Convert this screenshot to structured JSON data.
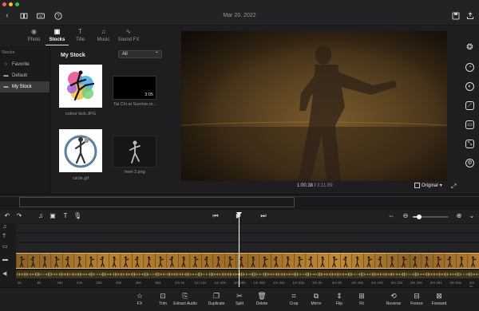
{
  "window": {
    "dots": [
      "#ff5f57",
      "#febc2e",
      "#28c840"
    ]
  },
  "header": {
    "date": "Mar 20, 2022"
  },
  "media_tabs": [
    {
      "label": "Photo",
      "icon": "photo-icon",
      "active": false
    },
    {
      "label": "Stocks",
      "icon": "stocks-icon",
      "active": true
    },
    {
      "label": "Title",
      "icon": "title-icon",
      "active": false
    },
    {
      "label": "Music",
      "icon": "music-icon",
      "active": false
    },
    {
      "label": "Sound FX",
      "icon": "sound-fx-icon",
      "active": false
    }
  ],
  "sidebar": {
    "title": "Stocks",
    "items": [
      {
        "label": "Favorite",
        "icon": "star-icon"
      },
      {
        "label": "Default",
        "icon": "folder-icon"
      },
      {
        "label": "My Stock",
        "icon": "folder-icon",
        "selected": true
      }
    ]
  },
  "stock": {
    "title": "My Stock",
    "filter": "All",
    "items": [
      {
        "name": "colour kick.JPG",
        "duration": ""
      },
      {
        "name": "Tai Chi at Sunrise.m...",
        "duration": "3:05"
      },
      {
        "name": "circle.gif",
        "duration": ""
      },
      {
        "name": "heel 2.png",
        "duration": ""
      }
    ]
  },
  "preview": {
    "current_time": "1:00.38",
    "total_time": "3:11.89",
    "quality": "Original"
  },
  "ruler": {
    "ticks": [
      "0s",
      "8s",
      "16s",
      "24s",
      "32s",
      "40s",
      "48s",
      "56s",
      "1m 4s",
      "1m 12s",
      "1m 20s",
      "1m 28s",
      "1m 36s",
      "1m 44s",
      "1m 52s",
      "2m 0s",
      "2m 8s",
      "2m 16s",
      "2m 24s",
      "2m 32s",
      "2m 40s",
      "2m 48s",
      "2m 56s",
      "3m 4s"
    ]
  },
  "bottom_toolbar": [
    {
      "label": "FX",
      "icon": "fx-icon"
    },
    {
      "label": "Trim",
      "icon": "trim-icon"
    },
    {
      "label": "Extract Audio",
      "icon": "extract-audio-icon"
    },
    {
      "label": "Duplicate",
      "icon": "duplicate-icon"
    },
    {
      "label": "Split",
      "icon": "scissors-icon"
    },
    {
      "label": "Delete",
      "icon": "trash-icon"
    },
    {
      "label": "Crop",
      "icon": "crop-icon"
    },
    {
      "label": "Mirror",
      "icon": "mirror-icon"
    },
    {
      "label": "Flip",
      "icon": "flip-icon"
    },
    {
      "label": "Fit",
      "icon": "fit-icon"
    },
    {
      "label": "Reverse",
      "icon": "reverse-icon"
    },
    {
      "label": "Freeze",
      "icon": "freeze-icon"
    },
    {
      "label": "Forward",
      "icon": "forward-icon"
    }
  ]
}
